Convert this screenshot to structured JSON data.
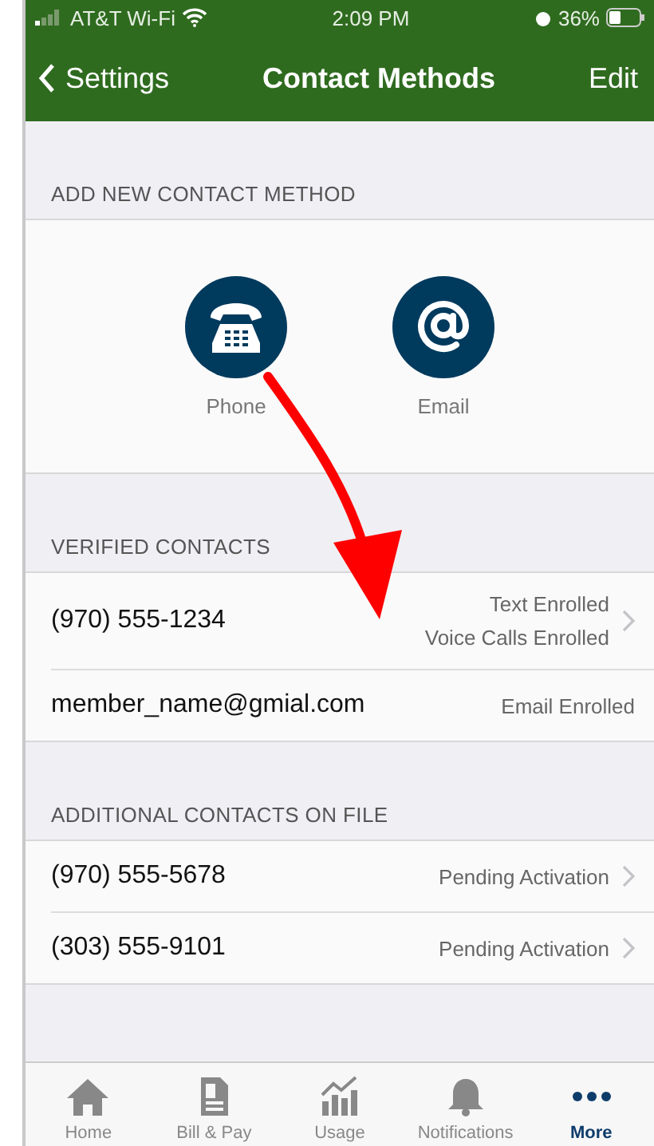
{
  "status_bar": {
    "carrier": "AT&T Wi-Fi",
    "time": "2:09 PM",
    "battery": "36%"
  },
  "nav_bar": {
    "back": "Settings",
    "title": "Contact Methods",
    "action": "Edit"
  },
  "add_section": {
    "header": "ADD NEW CONTACT METHOD",
    "options": [
      {
        "kind": "phone",
        "label": "Phone"
      },
      {
        "kind": "email",
        "label": "Email"
      }
    ]
  },
  "verified": {
    "header": "VERIFIED CONTACTS",
    "rows": [
      {
        "contact": "(970) 555-1234",
        "status": [
          "Text Enrolled",
          "Voice Calls Enrolled"
        ],
        "chevron": true
      },
      {
        "contact": "member_name@gmial.com",
        "status": [
          "Email Enrolled"
        ],
        "chevron": false
      }
    ]
  },
  "additional": {
    "header": "ADDITIONAL CONTACTS ON FILE",
    "rows": [
      {
        "contact": "(970) 555-5678",
        "status": [
          "Pending Activation"
        ],
        "chevron": true
      },
      {
        "contact": "(303) 555-9101",
        "status": [
          "Pending Activation"
        ],
        "chevron": true
      }
    ]
  },
  "tab_bar": [
    {
      "kind": "home",
      "label": "Home",
      "selected": false
    },
    {
      "kind": "bill",
      "label": "Bill & Pay",
      "selected": false
    },
    {
      "kind": "usage",
      "label": "Usage",
      "selected": false
    },
    {
      "kind": "bell",
      "label": "Notifications",
      "selected": false
    },
    {
      "kind": "more",
      "label": "More",
      "selected": true
    }
  ]
}
